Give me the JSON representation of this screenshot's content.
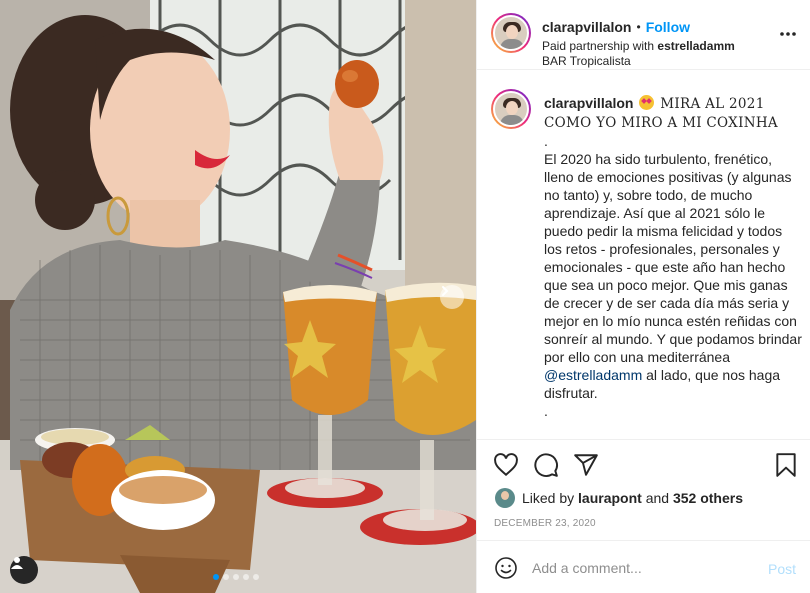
{
  "post": {
    "carousel": {
      "slide_count": 5,
      "active_slide": 1
    }
  },
  "header": {
    "username": "clarapvillalon",
    "separator": "•",
    "follow_label": "Follow",
    "partnership_prefix": "Paid partnership with ",
    "partner": "estrelladamm",
    "location": "BAR Tropicalista",
    "more_icon": "more-options-icon"
  },
  "caption": {
    "username": "clarapvillalon",
    "title": "MIRA AL 2021 COMO YO MIRO A MI COXINHA",
    "dot1": ".",
    "body": "El 2020 ha sido turbulento, frenético, lleno de emociones positivas (y algunas no tanto) y, sobre todo, de mucho aprendizaje. Así que al 2021 sólo le puedo pedir la misma felicidad y todos los retos - profesionales, personales y emocionales - que este año han hecho que sea un poco mejor. Que mis ganas de crecer y de ser cada día más seria y mejor en lo mío nunca estén reñidas con sonreír al mundo. Y que podamos brindar por ello con una mediterránea",
    "mention": "@estrelladamm",
    "body_end": " al lado, que nos haga disfrutar.",
    "dot2": "."
  },
  "actions": {
    "liked_prefix": "Liked by ",
    "liked_user": "laurapont",
    "liked_suffix": " and ",
    "others": "352 others",
    "date": "DECEMBER 23, 2020"
  },
  "comment": {
    "placeholder": "Add a comment...",
    "post_label": "Post"
  },
  "colors": {
    "accent": "#0095f6",
    "post_disabled": "#b2dffc",
    "text": "#262626",
    "muted": "#8e8e8e"
  }
}
